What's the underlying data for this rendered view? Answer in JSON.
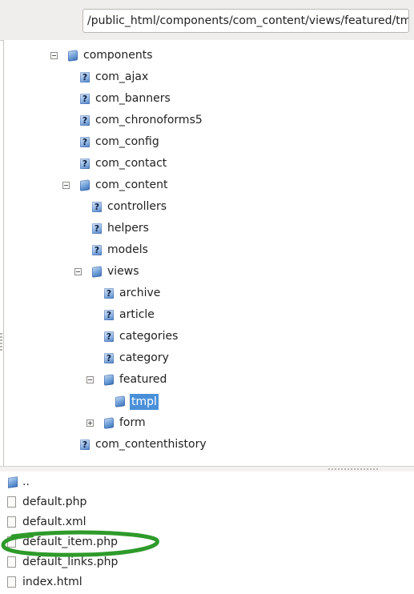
{
  "path_bar": {
    "path": "/public_html/components/com_content/views/featured/tmpl"
  },
  "tree": [
    {
      "label": "components",
      "kind": "folder",
      "expander": "minus",
      "depth": 0
    },
    {
      "label": "com_ajax",
      "kind": "unknown",
      "depth": 1
    },
    {
      "label": "com_banners",
      "kind": "unknown",
      "depth": 1
    },
    {
      "label": "com_chronoforms5",
      "kind": "unknown",
      "depth": 1
    },
    {
      "label": "com_config",
      "kind": "unknown",
      "depth": 1
    },
    {
      "label": "com_contact",
      "kind": "unknown",
      "depth": 1
    },
    {
      "label": "com_content",
      "kind": "folder",
      "expander": "minus",
      "depth": 1
    },
    {
      "label": "controllers",
      "kind": "unknown",
      "depth": 2
    },
    {
      "label": "helpers",
      "kind": "unknown",
      "depth": 2
    },
    {
      "label": "models",
      "kind": "unknown",
      "depth": 2
    },
    {
      "label": "views",
      "kind": "folder",
      "expander": "minus",
      "depth": 2
    },
    {
      "label": "archive",
      "kind": "unknown",
      "depth": 3
    },
    {
      "label": "article",
      "kind": "unknown",
      "depth": 3
    },
    {
      "label": "categories",
      "kind": "unknown",
      "depth": 3
    },
    {
      "label": "category",
      "kind": "unknown",
      "depth": 3
    },
    {
      "label": "featured",
      "kind": "folder",
      "expander": "minus",
      "depth": 3
    },
    {
      "label": "tmpl",
      "kind": "folder-open",
      "depth": 4,
      "selected": true
    },
    {
      "label": "form",
      "kind": "folder",
      "expander": "plus",
      "depth": 3
    },
    {
      "label": "com_contenthistory",
      "kind": "unknown",
      "depth": 1
    }
  ],
  "file_list": [
    {
      "name": "..",
      "kind": "parent"
    },
    {
      "name": "default.php",
      "kind": "file"
    },
    {
      "name": "default.xml",
      "kind": "file"
    },
    {
      "name": "default_item.php",
      "kind": "file",
      "highlighted": true
    },
    {
      "name": "default_links.php",
      "kind": "file"
    },
    {
      "name": "index.html",
      "kind": "file"
    }
  ],
  "colors": {
    "selection": "#4a90d9",
    "annotation": "#2e9a2a",
    "folder": "#6e9fd8"
  }
}
